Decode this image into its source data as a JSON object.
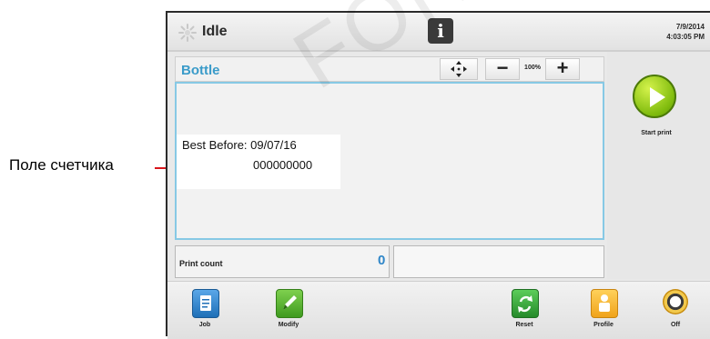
{
  "annotation": {
    "label": "Поле счетчика"
  },
  "watermark": {
    "text": "FOR"
  },
  "status": {
    "state": "Idle",
    "date": "7/9/2014",
    "time": "4:03:05 PM"
  },
  "editor": {
    "job_name": "Bottle",
    "zoom_level": "100%",
    "zoom_out_label": "−",
    "zoom_in_label": "+",
    "label_line1": "Best Before:  09/07/16",
    "label_line2": "000000000"
  },
  "counter": {
    "label": "Print count",
    "value": "0"
  },
  "start": {
    "label": "Start print"
  },
  "toolbar": {
    "job_label": "Job",
    "modify_label": "Modify",
    "reset_label": "Reset",
    "profile_label": "Profile",
    "off_label": "Off"
  },
  "icons": [
    "idle-status-icon",
    "info-icon",
    "move-icon",
    "zoom-out-icon",
    "zoom-in-icon",
    "play-icon",
    "job-icon",
    "modify-icon",
    "reset-icon",
    "profile-icon",
    "power-icon"
  ],
  "colors": {
    "accent_blue": "#3a9bc9",
    "count_blue": "#2f86c8",
    "canvas_border": "#87c9e5",
    "annotation_red": "#d8161c",
    "start_green": "#7fbb0d"
  }
}
